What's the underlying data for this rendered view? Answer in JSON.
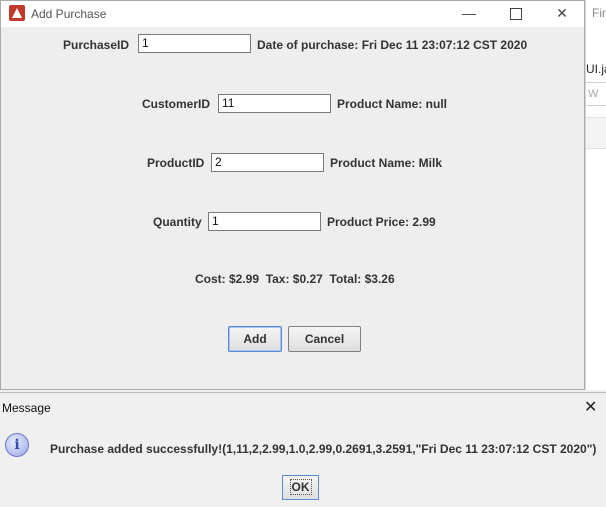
{
  "background_window": {
    "title": "Fir",
    "tab": "UI.ja",
    "field_hint": "W"
  },
  "dialog": {
    "title": "Add Purchase",
    "purchase_id_label": "PurchaseID",
    "purchase_id_value": "1",
    "date_label": "Date of purchase: Fri Dec 11 23:07:12 CST 2020",
    "customer_id_label": "CustomerID",
    "customer_id_value": "11",
    "customer_product_name": "Product Name: null",
    "product_id_label": "ProductID",
    "product_id_value": "2",
    "product_name": "Product Name: Milk",
    "quantity_label": "Quantity",
    "quantity_value": "1",
    "product_price": "Product Price: 2.99",
    "totals": "Cost: $2.99  Tax: $0.27  Total: $3.26",
    "add_label": "Add",
    "cancel_label": "Cancel"
  },
  "message": {
    "title": "Message",
    "text": "Purchase added successfully!(1,11,2,2.99,1.0,2.99,0.2691,3.2591,\"Fri Dec 11 23:07:12 CST 2020\")",
    "ok_label": "OK",
    "icon": "info-icon"
  }
}
